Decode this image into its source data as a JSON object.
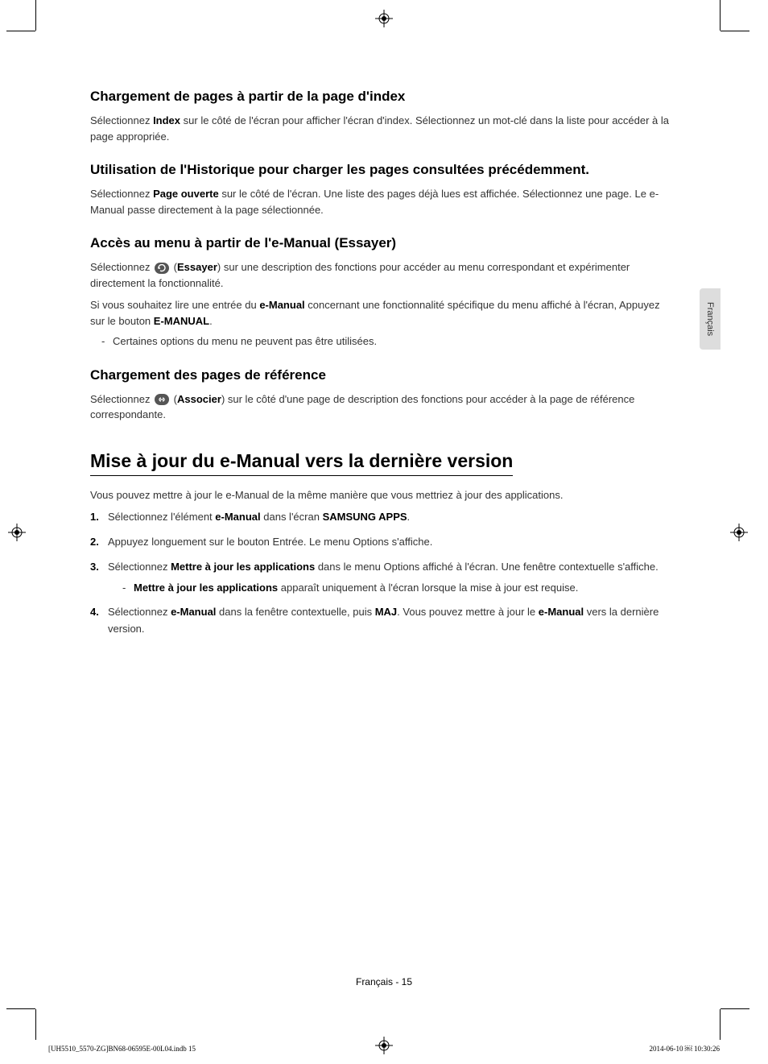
{
  "sideTab": "Français",
  "sections": [
    {
      "heading": "Chargement de pages à partir de la page d'index",
      "body_pre": "Sélectionnez ",
      "bold1": "Index",
      "body_post": " sur le côté de l'écran pour afficher l'écran d'index. Sélectionnez un mot-clé dans la liste pour accéder à la page appropriée."
    },
    {
      "heading": "Utilisation de l'Historique pour charger les pages consultées précédemment.",
      "body_pre": "Sélectionnez ",
      "bold1": "Page ouverte",
      "body_post": " sur le côté de l'écran. Une liste des pages déjà lues est affichée. Sélectionnez une page. Le e-Manual passe directement à la page sélectionnée."
    }
  ],
  "access": {
    "heading": "Accès au menu à partir de l'e-Manual (Essayer)",
    "p1_pre": "Sélectionnez ",
    "p1_label": "Essayer",
    "p1_post": ") sur une description des fonctions pour accéder au menu correspondant et expérimenter directement la fonctionnalité.",
    "p2_pre": "Si vous souhaitez lire une entrée du ",
    "p2_b1": "e-Manual",
    "p2_mid": " concernant une fonctionnalité spécifique du menu affiché à l'écran, Appuyez sur le bouton ",
    "p2_b2": "E-MANUAL",
    "p2_post": ".",
    "note": "Certaines options du menu ne peuvent pas être utilisées."
  },
  "ref": {
    "heading": "Chargement des pages de référence",
    "p_pre": "Sélectionnez ",
    "p_label": "Associer",
    "p_post": ") sur le côté d'une page de description des fonctions pour accéder à la page de référence correspondante."
  },
  "update": {
    "heading": "Mise à jour du e-Manual vers la dernière version",
    "intro": "Vous pouvez mettre à jour le e-Manual de la même manière que vous mettriez à jour des applications.",
    "step1_pre": "Sélectionnez l'élément ",
    "step1_b1": "e-Manual",
    "step1_mid": " dans l'écran ",
    "step1_b2": "SAMSUNG APPS",
    "step1_post": ".",
    "step2": "Appuyez longuement sur le bouton Entrée. Le menu Options s'affiche.",
    "step3_pre": "Sélectionnez ",
    "step3_b1": "Mettre à jour les applications",
    "step3_post": " dans le menu Options affiché à l'écran. Une fenêtre contextuelle s'affiche.",
    "step3_note_b": "Mettre à jour les applications",
    "step3_note_post": " apparaît uniquement à l'écran lorsque la mise à jour est requise.",
    "step4_pre": "Sélectionnez ",
    "step4_b1": "e-Manual",
    "step4_mid1": " dans la fenêtre contextuelle, puis ",
    "step4_b2": "MAJ",
    "step4_mid2": ". Vous pouvez mettre à jour le ",
    "step4_b3": "e-Manual",
    "step4_post": " vers la dernière version."
  },
  "footer": {
    "page": "Français - 15",
    "docLeft": "[UH5510_5570-ZG]BN68-06595E-00L04.indb   15",
    "docRight": "2014-06-10   ￼ 10:30:26"
  }
}
